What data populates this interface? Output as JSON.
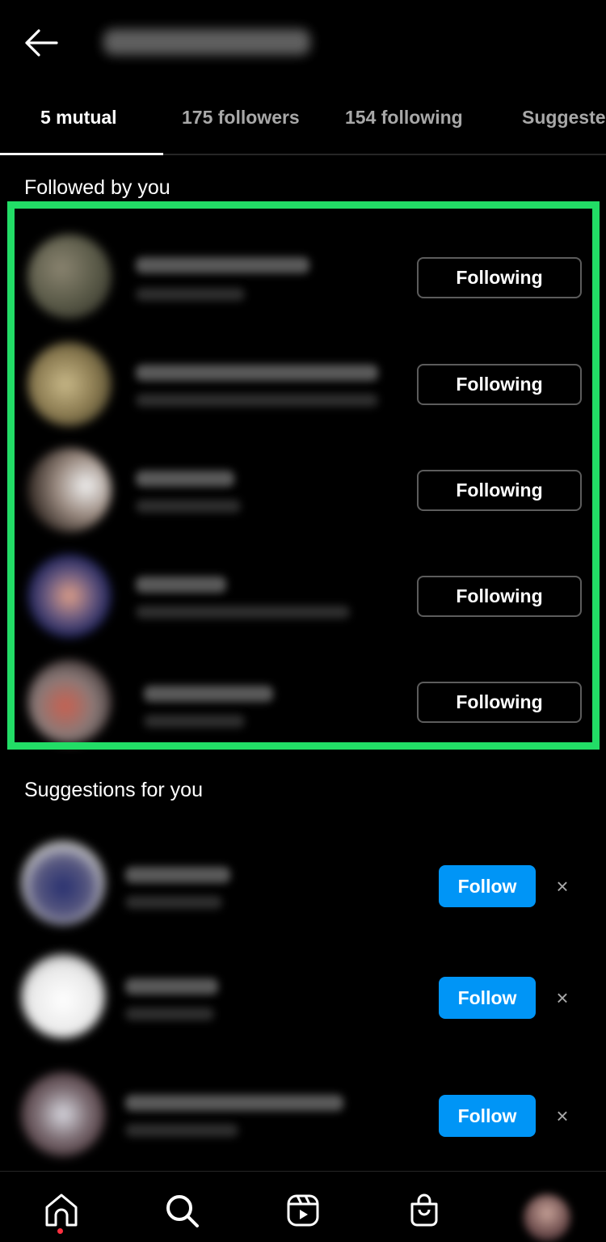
{
  "header": {
    "back_icon": "arrow-left-icon",
    "title_blurred": true
  },
  "tabs": [
    {
      "label": "5 mutual",
      "active": true
    },
    {
      "label": "175 followers",
      "active": false
    },
    {
      "label": "154 following",
      "active": false
    },
    {
      "label": "Suggested",
      "active": false
    }
  ],
  "followed_section": {
    "title": "Followed by you",
    "highlight_color": "#22dd66",
    "users": [
      {
        "button_label": "Following"
      },
      {
        "button_label": "Following"
      },
      {
        "button_label": "Following"
      },
      {
        "button_label": "Following"
      },
      {
        "button_label": "Following"
      }
    ]
  },
  "suggestions_section": {
    "title": "Suggestions for you",
    "users": [
      {
        "button_label": "Follow",
        "dismiss": "×"
      },
      {
        "button_label": "Follow",
        "dismiss": "×"
      },
      {
        "button_label": "Follow",
        "dismiss": "×"
      }
    ]
  },
  "bottom_nav": {
    "items": [
      "home-icon",
      "search-icon",
      "reels-icon",
      "shop-icon",
      "profile-avatar"
    ],
    "home_has_notification": true
  },
  "colors": {
    "follow_button": "#0095f6",
    "notification_dot": "#ff3040",
    "highlight_box": "#22dd66"
  }
}
